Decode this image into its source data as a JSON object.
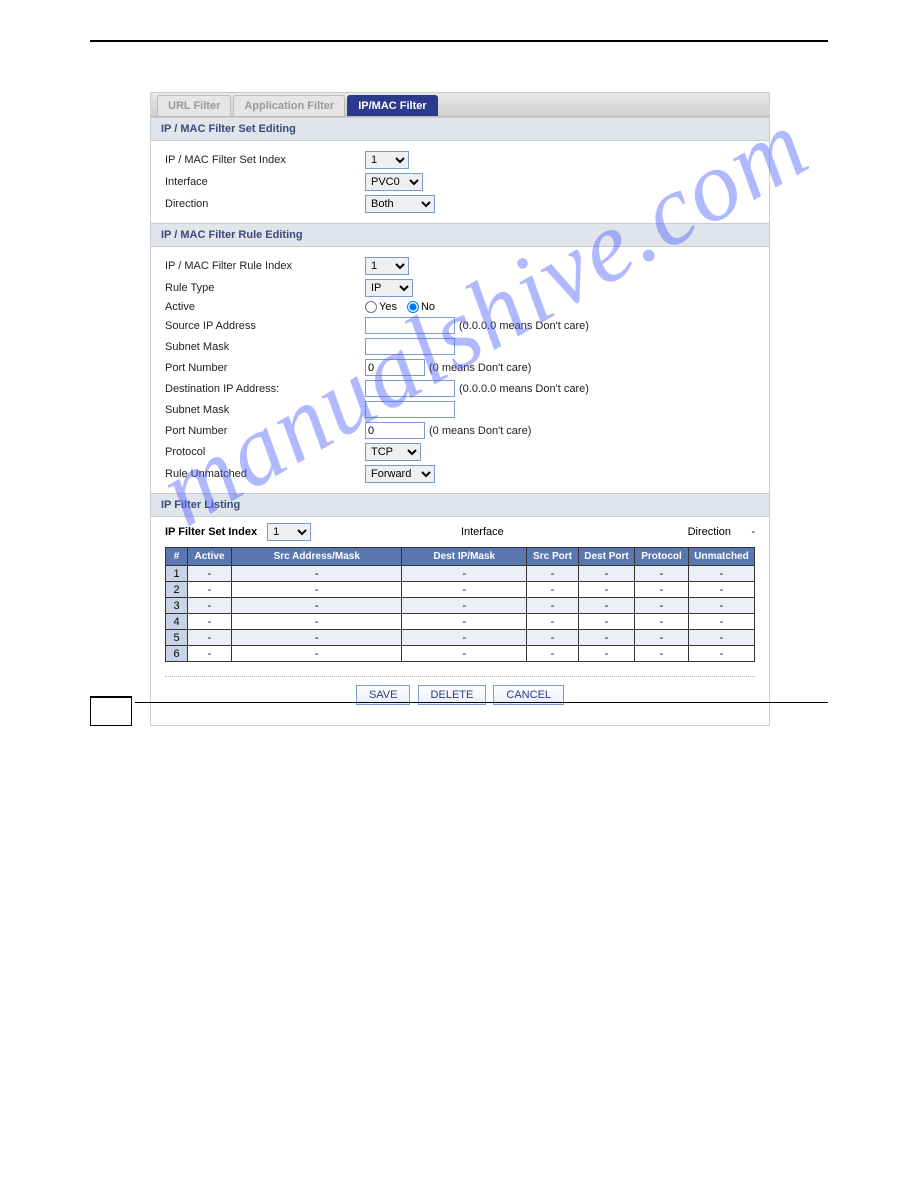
{
  "tabs": {
    "url_filter": "URL Filter",
    "app_filter": "Application Filter",
    "ipmac_filter": "IP/MAC Filter"
  },
  "section1": {
    "title": "IP / MAC Filter Set Editing",
    "set_index_label": "IP / MAC Filter Set Index",
    "set_index_value": "1",
    "interface_label": "Interface",
    "interface_value": "PVC0",
    "direction_label": "Direction",
    "direction_value": "Both"
  },
  "section2": {
    "title": "IP / MAC Filter Rule Editing",
    "rule_index_label": "IP / MAC Filter Rule Index",
    "rule_index_value": "1",
    "rule_type_label": "Rule Type",
    "rule_type_value": "IP",
    "active_label": "Active",
    "active_yes": "Yes",
    "active_no": "No",
    "src_ip_label": "Source IP Address",
    "src_ip_hint": "(0.0.0.0 means Don't care)",
    "subnet_label_1": "Subnet Mask",
    "port1_label": "Port Number",
    "port1_value": "0",
    "port1_hint": "(0 means Don't care)",
    "dst_ip_label": "Destination IP Address:",
    "dst_ip_hint": "(0.0.0.0 means Don't care)",
    "subnet_label_2": "Subnet Mask",
    "port2_label": "Port Number",
    "port2_value": "0",
    "port2_hint": "(0 means Don't care)",
    "protocol_label": "Protocol",
    "protocol_value": "TCP",
    "unmatched_label": "Rule Unmatched",
    "unmatched_value": "Forward"
  },
  "listing": {
    "title": "IP Filter Listing",
    "set_index_label": "IP Filter Set Index",
    "set_index_value": "1",
    "interface_label": "Interface",
    "interface_value": "",
    "direction_label": "Direction",
    "direction_value": "-",
    "headers": [
      "#",
      "Active",
      "Src Address/Mask",
      "Dest IP/Mask",
      "Src Port",
      "Dest Port",
      "Protocol",
      "Unmatched"
    ],
    "rows": [
      {
        "n": "1",
        "active": "-",
        "src": "-",
        "dst": "-",
        "sp": "-",
        "dp": "-",
        "pr": "-",
        "um": "-"
      },
      {
        "n": "2",
        "active": "-",
        "src": "-",
        "dst": "-",
        "sp": "-",
        "dp": "-",
        "pr": "-",
        "um": "-"
      },
      {
        "n": "3",
        "active": "-",
        "src": "-",
        "dst": "-",
        "sp": "-",
        "dp": "-",
        "pr": "-",
        "um": "-"
      },
      {
        "n": "4",
        "active": "-",
        "src": "-",
        "dst": "-",
        "sp": "-",
        "dp": "-",
        "pr": "-",
        "um": "-"
      },
      {
        "n": "5",
        "active": "-",
        "src": "-",
        "dst": "-",
        "sp": "-",
        "dp": "-",
        "pr": "-",
        "um": "-"
      },
      {
        "n": "6",
        "active": "-",
        "src": "-",
        "dst": "-",
        "sp": "-",
        "dp": "-",
        "pr": "-",
        "um": "-"
      }
    ]
  },
  "buttons": {
    "save": "SAVE",
    "delete": "DELETE",
    "cancel": "CANCEL"
  },
  "watermark": "manualshive.com"
}
